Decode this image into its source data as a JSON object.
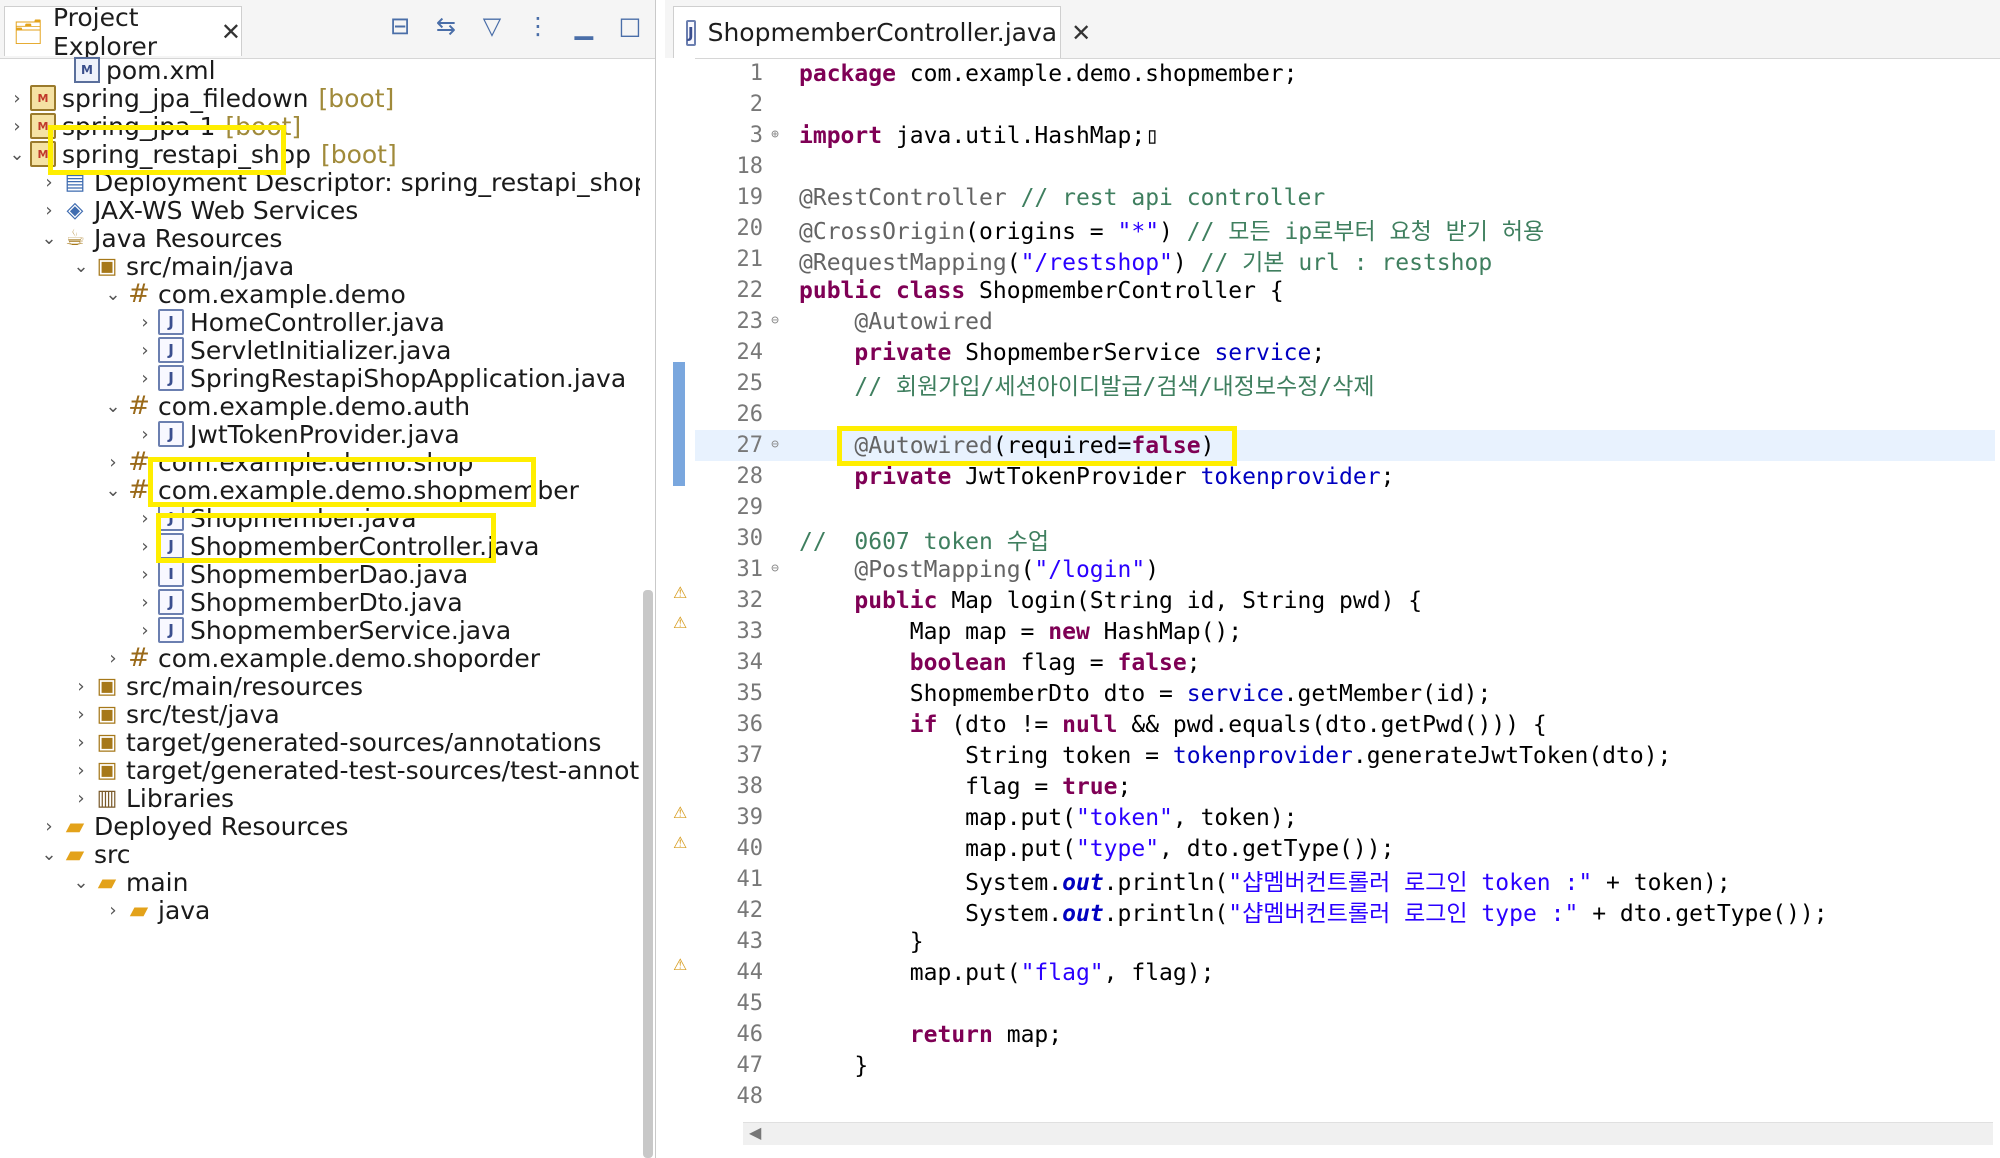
{
  "explorer": {
    "title": "Project Explorer",
    "close": "✕",
    "tools": [
      "collapse-all-icon",
      "link-with-editor-icon",
      "filter-icon",
      "view-menu-icon",
      "minimize-icon",
      "maximize-icon"
    ],
    "tools_glyphs": [
      "⊟",
      "⇆",
      "▽",
      "⋮",
      "▁",
      "□"
    ],
    "items": [
      {
        "label": "pom.xml",
        "boot": ""
      },
      {
        "label": "spring_jpa_filedown",
        "boot": "[boot]"
      },
      {
        "label": "spring_jpa-1",
        "boot": "[boot]"
      },
      {
        "label": "spring_restapi_shop",
        "boot": "[boot]"
      },
      {
        "label": "Deployment Descriptor: spring_restapi_shop",
        "boot": ""
      },
      {
        "label": "JAX-WS Web Services",
        "boot": ""
      },
      {
        "label": "Java Resources",
        "boot": ""
      },
      {
        "label": "src/main/java",
        "boot": ""
      },
      {
        "label": "com.example.demo",
        "boot": ""
      },
      {
        "label": "HomeController.java",
        "boot": ""
      },
      {
        "label": "ServletInitializer.java",
        "boot": ""
      },
      {
        "label": "SpringRestapiShopApplication.java",
        "boot": ""
      },
      {
        "label": "com.example.demo.auth",
        "boot": ""
      },
      {
        "label": "JwtTokenProvider.java",
        "boot": ""
      },
      {
        "label": "com.example.demo.shop",
        "boot": ""
      },
      {
        "label": "com.example.demo.shopmember",
        "boot": ""
      },
      {
        "label": "Shopmember.java",
        "boot": ""
      },
      {
        "label": "ShopmemberController.java",
        "boot": ""
      },
      {
        "label": "ShopmemberDao.java",
        "boot": ""
      },
      {
        "label": "ShopmemberDto.java",
        "boot": ""
      },
      {
        "label": "ShopmemberService.java",
        "boot": ""
      },
      {
        "label": "com.example.demo.shoporder",
        "boot": ""
      },
      {
        "label": "src/main/resources",
        "boot": ""
      },
      {
        "label": "src/test/java",
        "boot": ""
      },
      {
        "label": "target/generated-sources/annotations",
        "boot": ""
      },
      {
        "label": "target/generated-test-sources/test-annotations",
        "boot": ""
      },
      {
        "label": "Libraries",
        "boot": ""
      },
      {
        "label": "Deployed Resources",
        "boot": ""
      },
      {
        "label": "src",
        "boot": ""
      },
      {
        "label": "main",
        "boot": ""
      },
      {
        "label": "java",
        "boot": ""
      }
    ]
  },
  "editor": {
    "tab_label": "ShopmemberController.java",
    "close": "✕",
    "line_numbers": [
      "1",
      "2",
      "3",
      "18",
      "19",
      "20",
      "21",
      "22",
      "23",
      "24",
      "25",
      "26",
      "27",
      "28",
      "29",
      "30",
      "31",
      "32",
      "33",
      "34",
      "35",
      "36",
      "37",
      "38",
      "39",
      "40",
      "41",
      "42",
      "43",
      "44",
      "45",
      "46",
      "47",
      "48"
    ],
    "fold_markers": [
      "⊕",
      "⊖",
      "⊖",
      "⊖"
    ],
    "code": {
      "l1_kw": "package",
      "l1_rest": " com.example.demo.shopmember;",
      "l3_kw": "import",
      "l3_rest": " java.util.HashMap;",
      "l3_box": "▯",
      "l19_ann": "@RestController",
      "l19_cm": " // rest api controller",
      "l20_ann": "@CrossOrigin",
      "l20_p1": "(origins = ",
      "l20_str": "\"*\"",
      "l20_p2": ") ",
      "l20_cm": "// 모든 ip로부터 요청 받기 허용",
      "l21_ann": "@RequestMapping",
      "l21_p1": "(",
      "l21_str": "\"/restshop\"",
      "l21_p2": ") ",
      "l21_cm": "// 기본 url : restshop",
      "l22_kw1": "public",
      "l22_kw2": "class",
      "l22_rest": " ShopmemberController {",
      "l23_ann": "@Autowired",
      "l24_kw": "private",
      "l24_type": " ShopmemberService ",
      "l24_field": "service",
      "l24_end": ";",
      "l25_cm": "// 회원가입/세션아이디발급/검색/내정보수정/삭제",
      "l27_ann": "@Autowired",
      "l27_p1": "(required=",
      "l27_kw": "false",
      "l27_p2": ")",
      "l28_kw": "private",
      "l28_type": " JwtTokenProvider ",
      "l28_field": "tokenprovider",
      "l28_end": ";",
      "l30_cm": "//  0607 token 수업",
      "l31_ann": "@PostMapping",
      "l31_p1": "(",
      "l31_str": "\"/login\"",
      "l31_p2": ")",
      "l32_kw": "public",
      "l32_rest": " Map login(String id, String pwd) {",
      "l33_p1": "Map map = ",
      "l33_kw": "new",
      "l33_p2": " HashMap();",
      "l34_kw1": "boolean",
      "l34_p1": " flag = ",
      "l34_kw2": "false",
      "l34_end": ";",
      "l35_p1": "ShopmemberDto dto = ",
      "l35_field": "service",
      "l35_p2": ".getMember(id);",
      "l36_kw1": "if",
      "l36_p1": " (dto != ",
      "l36_kw2": "null",
      "l36_p2": " && pwd.equals(dto.getPwd())) {",
      "l37_p1": "String token = ",
      "l37_field": "tokenprovider",
      "l37_p2": ".generateJwtToken(dto);",
      "l38_p1": "flag = ",
      "l38_kw": "true",
      "l38_end": ";",
      "l39_p1": "map.put(",
      "l39_str": "\"token\"",
      "l39_p2": ", token);",
      "l40_p1": "map.put(",
      "l40_str": "\"type\"",
      "l40_p2": ", dto.getType());",
      "l41_p1": "System.",
      "l41_out": "out",
      "l41_p2": ".println(",
      "l41_str": "\"샵멤버컨트롤러 로그인 token :\"",
      "l41_p3": " + token);",
      "l42_p1": "System.",
      "l42_out": "out",
      "l42_p2": ".println(",
      "l42_str": "\"샵멤버컨트롤러 로그인 type :\"",
      "l42_p3": " + dto.getType());",
      "l43": "}",
      "l44_p1": "map.put(",
      "l44_str": "\"flag\"",
      "l44_p2": ", flag);",
      "l46_kw": "return",
      "l46_p1": " map;",
      "l47": "}"
    }
  }
}
